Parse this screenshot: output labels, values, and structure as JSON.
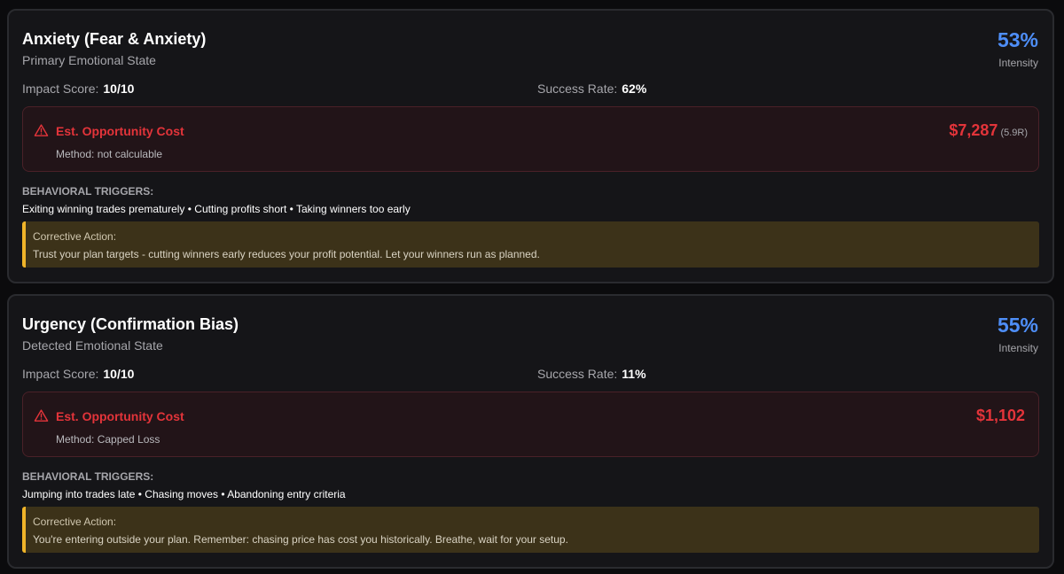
{
  "cards": [
    {
      "title": "Anxiety (Fear & Anxiety)",
      "subtitle": "Primary Emotional State",
      "intensity_value": "53%",
      "intensity_label": "Intensity",
      "impact_label": "Impact Score:",
      "impact_value": "10/10",
      "success_label": "Success Rate:",
      "success_value": "62%",
      "cost_title": "Est. Opportunity Cost",
      "cost_method": "Method: not calculable",
      "cost_value": "$7,287",
      "cost_r": "(5.9R)",
      "triggers_label": "BEHAVIORAL TRIGGERS:",
      "triggers": "Exiting winning trades prematurely • Cutting profits short • Taking winners too early",
      "action_label": "Corrective Action:",
      "action_text": "Trust your plan targets - cutting winners early reduces your profit potential. Let your winners run as planned."
    },
    {
      "title": "Urgency (Confirmation Bias)",
      "subtitle": "Detected Emotional State",
      "intensity_value": "55%",
      "intensity_label": "Intensity",
      "impact_label": "Impact Score:",
      "impact_value": "10/10",
      "success_label": "Success Rate:",
      "success_value": "11%",
      "cost_title": "Est. Opportunity Cost",
      "cost_method": "Method: Capped Loss",
      "cost_value": "$1,102",
      "cost_r": "",
      "triggers_label": "BEHAVIORAL TRIGGERS:",
      "triggers": "Jumping into trades late • Chasing moves • Abandoning entry criteria",
      "action_label": "Corrective Action:",
      "action_text": "You're entering outside your plan. Remember: chasing price has cost you historically. Breathe, wait for your setup."
    }
  ],
  "icons": {
    "cost_icon": "warning-triangle-icon"
  },
  "colors": {
    "accent_blue": "#4e8ef7",
    "danger_red": "#e3343a",
    "warning_yellow": "#f0b429",
    "card_bg": "#151518"
  }
}
